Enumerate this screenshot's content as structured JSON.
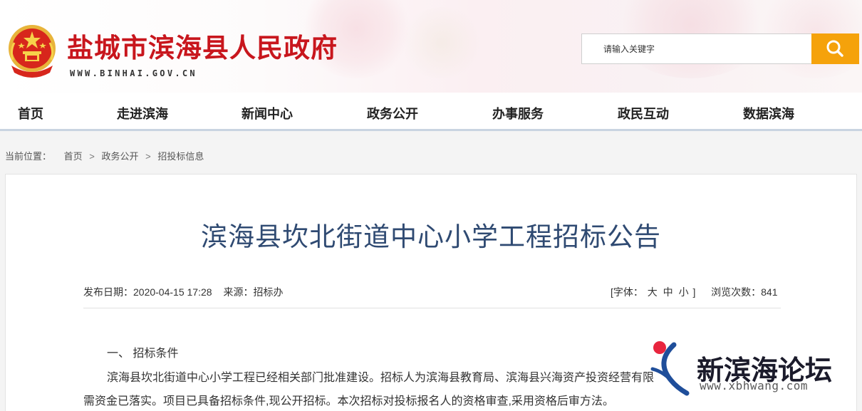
{
  "header": {
    "site_title": "盐城市滨海县人民政府",
    "site_domain": "WWW.BINHAI.GOV.CN",
    "search_placeholder": "请输入关键字",
    "search_button_icon": "search-icon",
    "accent_color": "#f5a20b",
    "title_color": "#c8161d"
  },
  "nav": {
    "items": [
      "首页",
      "走进滨海",
      "新闻中心",
      "政务公开",
      "办事服务",
      "政民互动",
      "数据滨海"
    ]
  },
  "breadcrumb": {
    "lead": "当前位置：",
    "items": [
      "首页",
      "政务公开",
      "招投标信息"
    ],
    "separator": ">"
  },
  "article": {
    "title": "滨海县坎北街道中心小学工程招标公告",
    "publish_label": "发布日期：",
    "publish_date": "2020-04-15 17:28",
    "source_label": "来源：",
    "source": "招标办",
    "font_size_label": "[字体：",
    "font_sizes": [
      "大",
      "中",
      "小"
    ],
    "font_size_close": "]",
    "views_label": "浏览次数：",
    "views": "841",
    "section_head": "一、 招标条件",
    "para_line1": "滨海县坎北街道中心小学工程已经相关部门批准建设。招标人为滨海县教育局、滨海县兴海资产投资经营有限",
    "para_line2": "需资金已落实。项目已具备招标条件,现公开招标。本次招标对投标报名人的资格审查,采用资格后审方法。",
    "title_color": "#2f4a72"
  },
  "watermark": {
    "name": "新滨海论坛",
    "url": "www.xbhwang.com"
  }
}
